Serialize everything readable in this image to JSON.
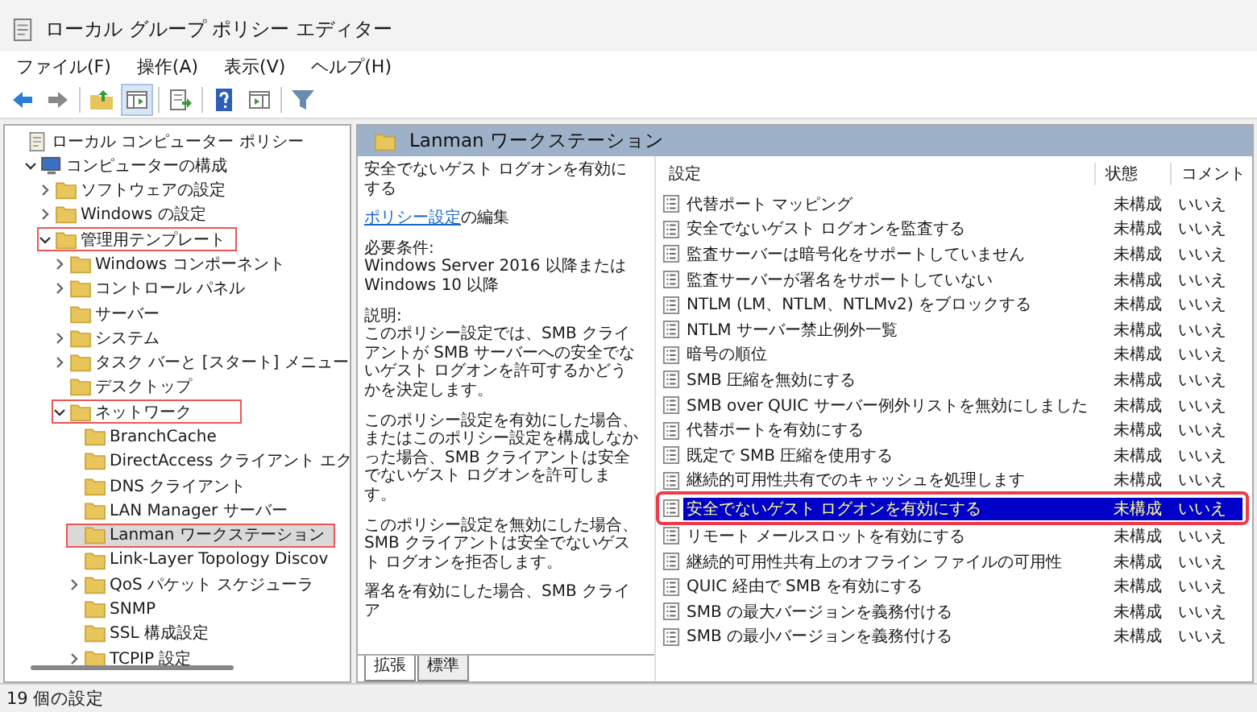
{
  "window": {
    "title": "ローカル グループ ポリシー エディター"
  },
  "menu": [
    "ファイル(F)",
    "操作(A)",
    "表示(V)",
    "ヘルプ(H)"
  ],
  "tree": [
    {
      "label": "ローカル コンピューター ポリシー",
      "kind": "root",
      "selected": false,
      "highlighted": false,
      "children": [
        {
          "label": "コンピューターの構成",
          "kind": "computer",
          "expanded": true,
          "selected": false,
          "highlighted": false,
          "children": [
            {
              "label": "ソフトウェアの設定",
              "kind": "folder",
              "expanded": false,
              "selected": false,
              "highlighted": false
            },
            {
              "label": "Windows の設定",
              "kind": "folder",
              "expanded": false,
              "selected": false,
              "highlighted": false
            },
            {
              "label": "管理用テンプレート",
              "kind": "folder",
              "expanded": true,
              "selected": false,
              "highlighted": true,
              "children": [
                {
                  "label": "Windows コンポーネント",
                  "kind": "folder",
                  "expanded": false,
                  "selected": false,
                  "highlighted": false
                },
                {
                  "label": "コントロール パネル",
                  "kind": "folder",
                  "expanded": false,
                  "selected": false,
                  "highlighted": false
                },
                {
                  "label": "サーバー",
                  "kind": "folder",
                  "selected": false,
                  "highlighted": false
                },
                {
                  "label": "システム",
                  "kind": "folder",
                  "expanded": false,
                  "selected": false,
                  "highlighted": false
                },
                {
                  "label": "タスク バーと [スタート] メニュー",
                  "kind": "folder",
                  "expanded": false,
                  "selected": false,
                  "highlighted": false
                },
                {
                  "label": "デスクトップ",
                  "kind": "folder",
                  "selected": false,
                  "highlighted": false
                },
                {
                  "label": "ネットワーク",
                  "kind": "folder",
                  "expanded": true,
                  "selected": false,
                  "highlighted": true,
                  "children": [
                    {
                      "label": "BranchCache",
                      "kind": "folder",
                      "selected": false,
                      "highlighted": false
                    },
                    {
                      "label": "DirectAccess クライアント エク",
                      "kind": "folder",
                      "selected": false,
                      "highlighted": false
                    },
                    {
                      "label": "DNS クライアント",
                      "kind": "folder",
                      "selected": false,
                      "highlighted": false
                    },
                    {
                      "label": "LAN Manager サーバー",
                      "kind": "folder",
                      "selected": false,
                      "highlighted": false
                    },
                    {
                      "label": "Lanman ワークステーション",
                      "kind": "folder",
                      "selected": true,
                      "highlighted": true
                    },
                    {
                      "label": "Link-Layer Topology Discov",
                      "kind": "folder",
                      "selected": false,
                      "highlighted": false
                    },
                    {
                      "label": "QoS パケット スケジューラ",
                      "kind": "folder",
                      "expanded": false,
                      "selected": false,
                      "highlighted": false
                    },
                    {
                      "label": "SNMP",
                      "kind": "folder",
                      "selected": false,
                      "highlighted": false
                    },
                    {
                      "label": "SSL 構成設定",
                      "kind": "folder",
                      "selected": false,
                      "highlighted": false
                    },
                    {
                      "label": "TCPIP 設定",
                      "kind": "folder",
                      "expanded": false,
                      "selected": false,
                      "highlighted": false
                    }
                  ]
                }
              ]
            }
          ]
        }
      ]
    }
  ],
  "header": {
    "title": "Lanman ワークステーション"
  },
  "description": {
    "policy_title": "安全でないゲスト ログオンを有効にする",
    "link": "ポリシー設定",
    "link_suffix": "の編集",
    "paragraphs": [
      "必要条件:\nWindows Server 2016 以降または Windows 10 以降",
      "説明:\nこのポリシー設定では、SMB クライアントが SMB サーバーへの安全でないゲスト ログオンを許可するかどうかを決定します。",
      "このポリシー設定を有効にした場合、またはこのポリシー設定を構成しなかった場合、SMB クライアントは安全でないゲスト ログオンを許可します。",
      "このポリシー設定を無効にした場合、SMB クライアントは安全でないゲスト ログオンを拒否します。",
      "署名を有効にした場合、SMB クライア"
    ],
    "tabs": [
      {
        "label": "拡張",
        "selected": true
      },
      {
        "label": "標準",
        "selected": false
      }
    ]
  },
  "table": {
    "columns": [
      "設定",
      "状態",
      "コメント"
    ],
    "rows": [
      {
        "setting": "代替ポート マッピング",
        "state": "未構成",
        "comment": "いいえ",
        "selected": false,
        "highlighted": false
      },
      {
        "setting": "安全でないゲスト ログオンを監査する",
        "state": "未構成",
        "comment": "いいえ",
        "selected": false,
        "highlighted": false
      },
      {
        "setting": "監査サーバーは暗号化をサポートしていません",
        "state": "未構成",
        "comment": "いいえ",
        "selected": false,
        "highlighted": false
      },
      {
        "setting": "監査サーバーが署名をサポートしていない",
        "state": "未構成",
        "comment": "いいえ",
        "selected": false,
        "highlighted": false
      },
      {
        "setting": "NTLM (LM、NTLM、NTLMv2) をブロックする",
        "state": "未構成",
        "comment": "いいえ",
        "selected": false,
        "highlighted": false
      },
      {
        "setting": "NTLM サーバー禁止例外一覧",
        "state": "未構成",
        "comment": "いいえ",
        "selected": false,
        "highlighted": false
      },
      {
        "setting": "暗号の順位",
        "state": "未構成",
        "comment": "いいえ",
        "selected": false,
        "highlighted": false
      },
      {
        "setting": "SMB 圧縮を無効にする",
        "state": "未構成",
        "comment": "いいえ",
        "selected": false,
        "highlighted": false
      },
      {
        "setting": "SMB over QUIC サーバー例外リストを無効にしました",
        "state": "未構成",
        "comment": "いいえ",
        "selected": false,
        "highlighted": false
      },
      {
        "setting": "代替ポートを有効にする",
        "state": "未構成",
        "comment": "いいえ",
        "selected": false,
        "highlighted": false
      },
      {
        "setting": "既定で SMB 圧縮を使用する",
        "state": "未構成",
        "comment": "いいえ",
        "selected": false,
        "highlighted": false
      },
      {
        "setting": "継続的可用性共有でのキャッシュを処理します",
        "state": "未構成",
        "comment": "いいえ",
        "selected": false,
        "highlighted": false
      },
      {
        "setting": "安全でないゲスト ログオンを有効にする",
        "state": "未構成",
        "comment": "いいえ",
        "selected": true,
        "highlighted": true
      },
      {
        "setting": "リモート メールスロットを有効にする",
        "state": "未構成",
        "comment": "いいえ",
        "selected": false,
        "highlighted": false
      },
      {
        "setting": "継続的可用性共有上のオフライン ファイルの可用性",
        "state": "未構成",
        "comment": "いいえ",
        "selected": false,
        "highlighted": false
      },
      {
        "setting": "QUIC 経由で SMB を有効にする",
        "state": "未構成",
        "comment": "いいえ",
        "selected": false,
        "highlighted": false
      },
      {
        "setting": "SMB の最大バージョンを義務付ける",
        "state": "未構成",
        "comment": "いいえ",
        "selected": false,
        "highlighted": false
      },
      {
        "setting": "SMB の最小バージョンを義務付ける",
        "state": "未構成",
        "comment": "いいえ",
        "selected": false,
        "highlighted": false
      }
    ]
  },
  "status_bar": {
    "text": "19 個の設定"
  }
}
